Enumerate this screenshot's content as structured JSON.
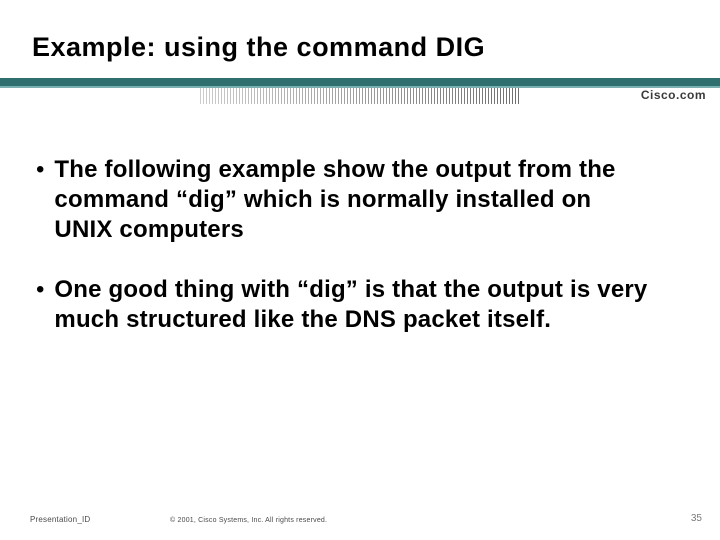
{
  "title": "Example: using the command DIG",
  "logo_text": "Cisco.com",
  "bullets": [
    "The following example show the output from the command “dig” which is normally installed on UNIX computers",
    "One good thing with “dig” is that the output is very much structured like the DNS packet itself."
  ],
  "footer": {
    "presentation_id": "Presentation_ID",
    "copyright": "© 2001, Cisco Systems, Inc. All rights reserved.",
    "page_number": "35"
  }
}
